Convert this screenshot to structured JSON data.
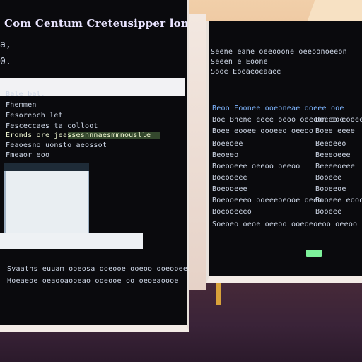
{
  "left_screen": {
    "title": "Com Centum Creteusipper lonis",
    "section_items": [
      "Bale bal.",
      "Fhemmen",
      "Fesoreoch let",
      "Fesceccaes ta colloot",
      "Eronds ore jeassesnnnaesmmnouslle",
      "Feaoesno uonsto aeossot",
      "Fmeaor eoo"
    ],
    "footer_lines": [
      "Svaaths euuam ooeosa ooeooe ooeoo ooeooee",
      "Hoeaeoe oeaooaooeao ooeooe oo oeoeaoooe"
    ]
  },
  "right_screen": {
    "header_lines": [
      "Seene eane oeeooone oeeoonoeeon",
      "Seeen e Eoone",
      "Sooe Eoeaeoeaaee"
    ],
    "table_header": "Beoo Eoonee ooeoneae ooeee ooe",
    "rows": [
      {
        "left": "Boe Bnene eeee oeoo oeeoon ooe",
        "right": "Boeeo eooee"
      },
      {
        "left": "Boee eooee oooeeo oeeoo",
        "right": "Boee eeee"
      },
      {
        "left": "Boeeoee",
        "right": "Beeoeeo"
      },
      {
        "left": "Beoeeo",
        "right": "Beeeoeee"
      },
      {
        "left": "Boeooeee oeeoo oeeoo",
        "right": "Beeeeoeee"
      },
      {
        "left": "Boeooeee",
        "right": "Booeee"
      },
      {
        "left": "Boeooeee",
        "right": "Booeeoe"
      },
      {
        "left": "Boeooeeeo ooeeeoeooe oeeo",
        "right": "Booeee eooo"
      },
      {
        "left": "Boeooeeeo",
        "right": "Booeee"
      }
    ],
    "bottom_line": "Soeoeo oeoe oeeoo ooeoeoeoo oeeoo oo oeeooeoe"
  }
}
